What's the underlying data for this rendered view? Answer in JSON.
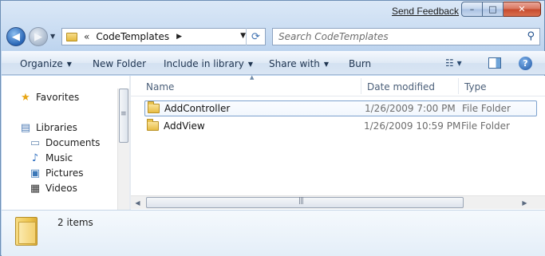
{
  "titlebar": {
    "feedback_link": "Send Feedback",
    "minimize_glyph": "–",
    "maximize_glyph": "□",
    "close_glyph": "✕"
  },
  "addressbar": {
    "separator": "«",
    "path": "CodeTemplates",
    "chevron": "▶",
    "dropdown": "▼"
  },
  "search": {
    "placeholder": "Search CodeTemplates"
  },
  "toolbar": {
    "items": [
      {
        "label": "Organize",
        "has_arrow": true
      },
      {
        "label": "New Folder",
        "has_arrow": false
      },
      {
        "label": "Include in library",
        "has_arrow": true
      },
      {
        "label": "Share with",
        "has_arrow": true
      },
      {
        "label": "Burn",
        "has_arrow": false
      }
    ],
    "view_glyph": "☷ ▾",
    "help_glyph": "?"
  },
  "navpane": {
    "favorites": {
      "label": "Favorites",
      "icon": "star-icon"
    },
    "libraries": {
      "label": "Libraries",
      "icon": "libraries-icon"
    },
    "library_items": [
      {
        "label": "Documents",
        "icon": "documents-icon"
      },
      {
        "label": "Music",
        "icon": "music-icon"
      },
      {
        "label": "Pictures",
        "icon": "pictures-icon"
      },
      {
        "label": "Videos",
        "icon": "videos-icon"
      }
    ]
  },
  "filelist": {
    "columns": {
      "name": "Name",
      "date": "Date modified",
      "type": "Type"
    },
    "rows": [
      {
        "name": "AddController",
        "date": "1/26/2009 7:00 PM",
        "type": "File Folder",
        "selected": true
      },
      {
        "name": "AddView",
        "date": "1/26/2009 10:59 PM",
        "type": "File Folder",
        "selected": false
      }
    ]
  },
  "details": {
    "item_count": "2 items"
  },
  "colors": {
    "chrome": "#c9dcf2",
    "selection_border": "#7da2ce",
    "folder": "#e7bc44"
  }
}
